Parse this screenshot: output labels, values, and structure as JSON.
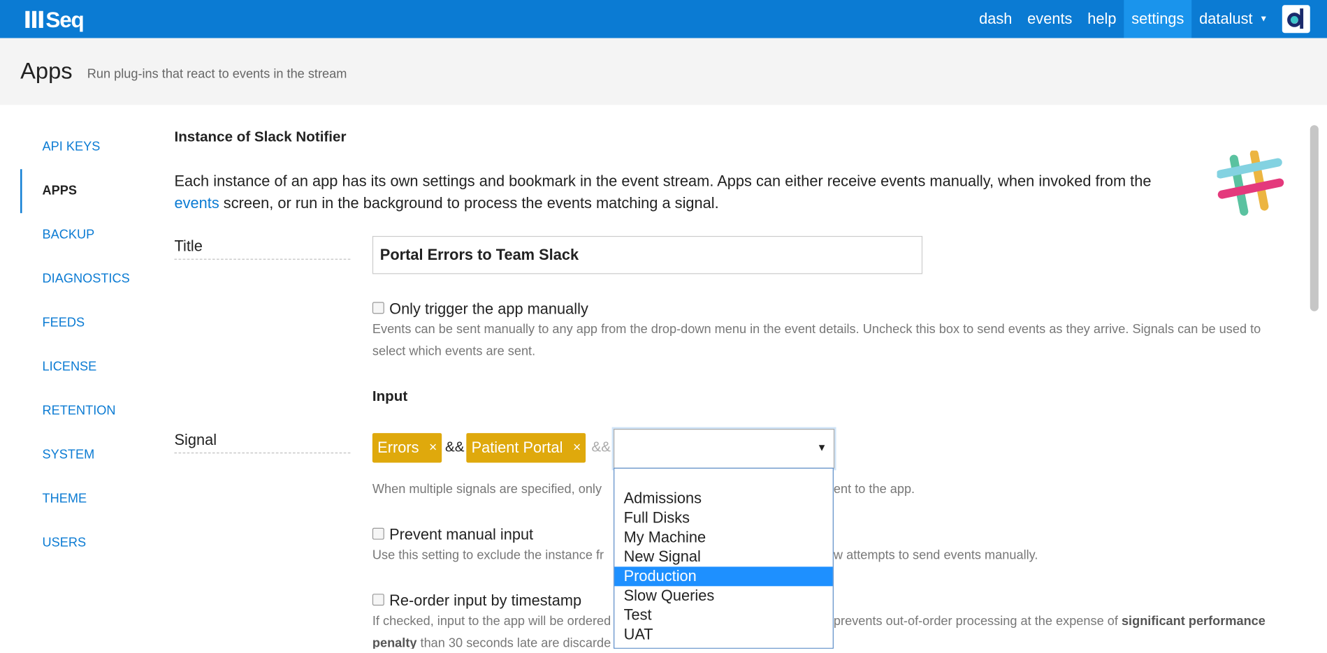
{
  "app": {
    "logo_text": "Seq"
  },
  "topnav": {
    "items": [
      {
        "label": "dash"
      },
      {
        "label": "events"
      },
      {
        "label": "help"
      },
      {
        "label": "settings",
        "active": true
      }
    ],
    "user": "datalust",
    "caret": "▼"
  },
  "page": {
    "title": "Apps",
    "subtitle": "Run plug-ins that react to events in the stream"
  },
  "sidebar": {
    "items": [
      {
        "label": "API KEYS"
      },
      {
        "label": "APPS",
        "active": true
      },
      {
        "label": "BACKUP"
      },
      {
        "label": "DIAGNOSTICS"
      },
      {
        "label": "FEEDS"
      },
      {
        "label": "LICENSE"
      },
      {
        "label": "RETENTION"
      },
      {
        "label": "SYSTEM"
      },
      {
        "label": "THEME"
      },
      {
        "label": "USERS"
      }
    ]
  },
  "main": {
    "heading": "Instance of Slack Notifier",
    "intro_before": "Each instance of an app has its own settings and bookmark in the event stream. Apps can either receive events manually, when invoked from the ",
    "intro_link": "events",
    "intro_after": " screen, or run in the background to process the events matching a signal.",
    "title_label": "Title",
    "title_value": "Portal Errors to Team Slack",
    "manual_label": "Only trigger the app manually",
    "manual_help": "Events can be sent manually to any app from the drop-down menu in the event details. Uncheck this box to send events as they arrive. Signals can be used to select which events are sent.",
    "input_heading": "Input",
    "signal_label": "Signal",
    "signal_tags": [
      "Errors",
      "Patient Portal"
    ],
    "tag_remove": "×",
    "and_op": "&&",
    "signal_help_left": "When multiple signals are specified, only",
    "signal_help_right": "ent to the app.",
    "prevent_label": "Prevent manual input",
    "prevent_help_left": "Use this setting to exclude the instance fr",
    "prevent_help_right": "w attempts to send events manually.",
    "reorder_label": "Re-order input by timestamp",
    "reorder_help_left": "If checked, input to the app will be ordered",
    "reorder_help_right": "prevents out-of-order processing at the expense of ",
    "reorder_help_bold": "significant performance",
    "reorder_help_line2_bold": "penalty",
    "reorder_help_line2": " than 30 seconds late are discarde",
    "select_arrow": "▼",
    "dropdown_options": [
      "Admissions",
      "Full Disks",
      "My Machine",
      "New Signal",
      "Production",
      "Slow Queries",
      "Test",
      "UAT"
    ],
    "dropdown_selected": "Production"
  },
  "colors": {
    "topbar": "#0b7bd3",
    "active_nav": "#1a94ec",
    "tag": "#dfa90c",
    "link": "#0b7bd3",
    "selected_option": "#1e90ff"
  }
}
